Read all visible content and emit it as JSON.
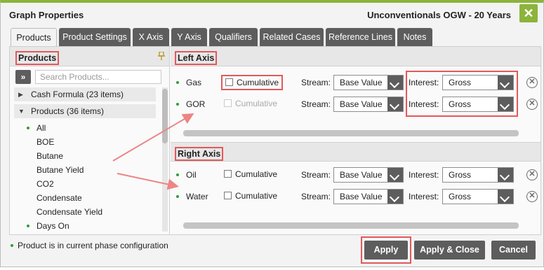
{
  "window": {
    "title": "Graph Properties",
    "subtitle": "Unconventionals OGW - 20 Years",
    "close_icon": "close-icon"
  },
  "tabs": [
    {
      "label": "Products",
      "active": true
    },
    {
      "label": "Product Settings",
      "active": false
    },
    {
      "label": "X Axis",
      "active": false
    },
    {
      "label": "Y Axis",
      "active": false
    },
    {
      "label": "Qualifiers",
      "active": false
    },
    {
      "label": "Related Cases",
      "active": false
    },
    {
      "label": "Reference Lines",
      "active": false
    },
    {
      "label": "Notes",
      "active": false
    }
  ],
  "products_panel": {
    "heading": "Products",
    "search_placeholder": "Search Products...",
    "expand_label": "»",
    "groups": [
      {
        "label": "Cash Formula (23 items)",
        "expanded": false
      },
      {
        "label": "Products (36 items)",
        "expanded": true
      }
    ],
    "items": [
      {
        "label": "All",
        "in_phase": true
      },
      {
        "label": "BOE",
        "in_phase": false
      },
      {
        "label": "Butane",
        "in_phase": false
      },
      {
        "label": "Butane Yield",
        "in_phase": false
      },
      {
        "label": "CO2",
        "in_phase": false
      },
      {
        "label": "Condensate",
        "in_phase": false
      },
      {
        "label": "Condensate Yield",
        "in_phase": false
      },
      {
        "label": "Days On",
        "in_phase": true
      }
    ]
  },
  "left_axis": {
    "heading": "Left Axis",
    "rows": [
      {
        "name": "Gas",
        "cumulative_label": "Cumulative",
        "cumulative_enabled": true,
        "stream_label": "Stream:",
        "stream": "Base Value",
        "interest_label": "Interest:",
        "interest": "Gross"
      },
      {
        "name": "GOR",
        "cumulative_label": "Cumulative",
        "cumulative_enabled": false,
        "stream_label": "Stream:",
        "stream": "Base Value",
        "interest_label": "Interest:",
        "interest": "Gross"
      }
    ]
  },
  "right_axis": {
    "heading": "Right Axis",
    "rows": [
      {
        "name": "Oil",
        "cumulative_label": "Cumulative",
        "cumulative_enabled": true,
        "stream_label": "Stream:",
        "stream": "Base Value",
        "interest_label": "Interest:",
        "interest": "Gross"
      },
      {
        "name": "Water",
        "cumulative_label": "Cumulative",
        "cumulative_enabled": true,
        "stream_label": "Stream:",
        "stream": "Base Value",
        "interest_label": "Interest:",
        "interest": "Gross"
      }
    ]
  },
  "footer": {
    "note": "Product is in current phase configuration",
    "apply": "Apply",
    "apply_close": "Apply & Close",
    "cancel": "Cancel"
  },
  "colors": {
    "accent": "#8cb43c",
    "highlight": "#e2595a",
    "dark": "#5d5d5d",
    "bullet": "#2f9b3a"
  }
}
